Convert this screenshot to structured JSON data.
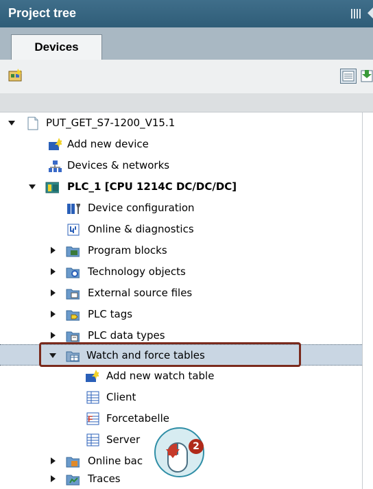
{
  "panel": {
    "title": "Project tree"
  },
  "tabs": [
    {
      "label": "Devices"
    }
  ],
  "tree": {
    "project": "PUT_GET_S7-1200_V15.1",
    "add_device": "Add new device",
    "devices_networks": "Devices & networks",
    "plc": "PLC_1 [CPU 1214C DC/DC/DC]",
    "device_config": "Device configuration",
    "online_diag": "Online & diagnostics",
    "program_blocks": "Program blocks",
    "tech_objects": "Technology objects",
    "external_sources": "External source files",
    "plc_tags": "PLC tags",
    "plc_datatypes": "PLC data types",
    "watch_force": "Watch and force tables",
    "add_watch": "Add new watch table",
    "client": "Client",
    "forcetabelle": "Forcetabelle",
    "server": "Server",
    "online_backups": "Online bac",
    "traces": "Traces"
  },
  "callout": {
    "step": "2"
  },
  "colors": {
    "titlebar": "#3a6885",
    "selection": "#c9d6e3",
    "highlight": "#7a2a1c",
    "step_badge": "#b02a1a"
  }
}
